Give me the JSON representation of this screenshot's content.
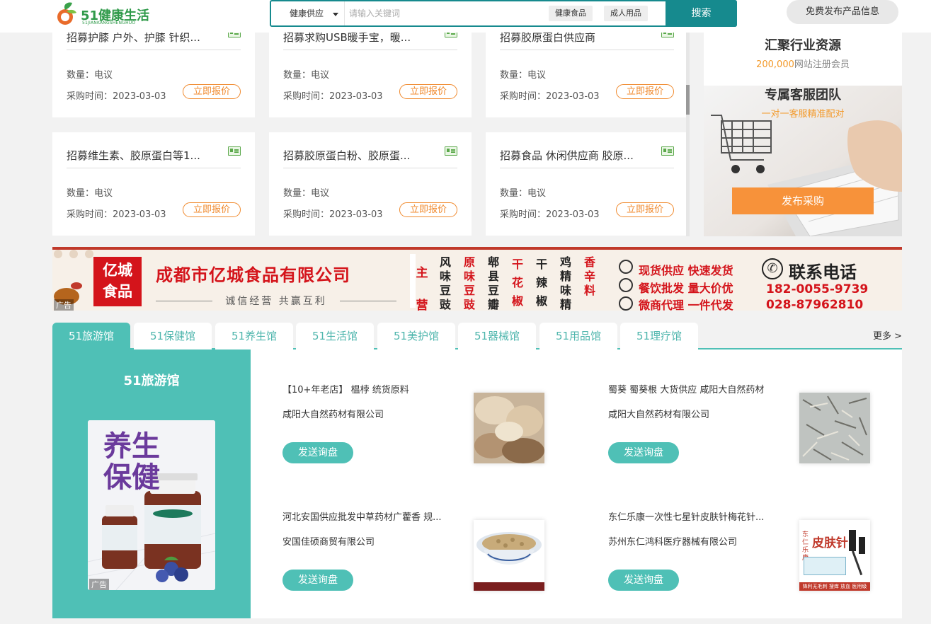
{
  "header": {
    "logo_text": "51健康生活",
    "logo_sub": "51JIANKANGSHENGHUO",
    "search_type": "健康供应",
    "search_placeholder": "请输入关键词",
    "tags": [
      "健康食品",
      "成人用品"
    ],
    "search_button": "搜索",
    "publish_button": "免费发布产品信息"
  },
  "cards": [
    {
      "title": "招募护膝 户外、护膝 针织...",
      "qty": "数量：电议",
      "time": "采购时间：2023-03-03",
      "button": "立即报价"
    },
    {
      "title": "招募求购USB暖手宝，暖...",
      "qty": "数量：电议",
      "time": "采购时间：2023-03-03",
      "button": "立即报价"
    },
    {
      "title": "招募胶原蛋白供应商",
      "qty": "数量：电议",
      "time": "采购时间：2023-03-03",
      "button": "立即报价"
    },
    {
      "title": "招募维生素、胶原蛋白等1...",
      "qty": "数量：电议",
      "time": "采购时间：2023-03-03",
      "button": "立即报价"
    },
    {
      "title": "招募胶原蛋白粉、胶原蛋...",
      "qty": "数量：电议",
      "time": "采购时间：2023-03-03",
      "button": "立即报价"
    },
    {
      "title": "招募食品 休闲供应商 胶原...",
      "qty": "数量：电议",
      "time": "采购时间：2023-03-03",
      "button": "立即报价"
    }
  ],
  "promo": {
    "title1": "汇聚行业资源",
    "members_count": "200,000",
    "members_text": "网站注册会员",
    "title2": "专属客服团队",
    "sub2": "一对一客服精准配对",
    "button": "发布采购"
  },
  "ad_banner": {
    "logo_line1": "亿城",
    "logo_line2": "食品",
    "company": "成都市亿城食品有限公司",
    "slogan": "诚信经营  共赢互利",
    "main_label": "主营",
    "products": [
      "风味豆豉",
      "原味豆豉",
      "郫县豆瓣",
      "干花椒",
      "干辣椒",
      "鸡精味精",
      "香辛料"
    ],
    "services": [
      "现货供应 快速发货",
      "餐饮批发 量大价优",
      "微商代理 一件代发"
    ],
    "contact_label": "联系电话",
    "phone1": "182-0055-9739",
    "phone2": "028-87962810",
    "ad_label": "广告"
  },
  "tabs": [
    "51旅游馆",
    "51保健馆",
    "51养生馆",
    "51生活馆",
    "51美护馆",
    "51器械馆",
    "51用品馆",
    "51理疗馆"
  ],
  "more": "更多 >",
  "panel": {
    "title": "51旅游馆",
    "ad_text_line1": "养生",
    "ad_text_line2": "保健",
    "ad_label": "广告"
  },
  "products": [
    {
      "title": "【10+年老店】 榅桲 统货原料",
      "company": "咸阳大自然药材有限公司",
      "button": "发送询盘"
    },
    {
      "title": "蜀葵 蜀葵根 大货供应 咸阳大自然药材",
      "company": "咸阳大自然药材有限公司",
      "button": "发送询盘"
    },
    {
      "title": "河北安国供应批发中草药材广藿香 规...",
      "company": "安国佳硕商贸有限公司",
      "button": "发送询盘"
    },
    {
      "title": "东仁乐康一次性七星针皮肤针梅花针...",
      "company": "苏州东仁鸿科医疗器械有限公司",
      "button": "发送询盘"
    }
  ],
  "product4_img": {
    "brand": "东仁乐康",
    "name": "皮肤针",
    "footer": "锋利无毛刺 搜痒 放血 医用级"
  },
  "colors": {
    "teal": "#4fc0b6",
    "dark_teal": "#168a8e",
    "orange": "#f08a2e",
    "ad_red": "#d4141b"
  }
}
